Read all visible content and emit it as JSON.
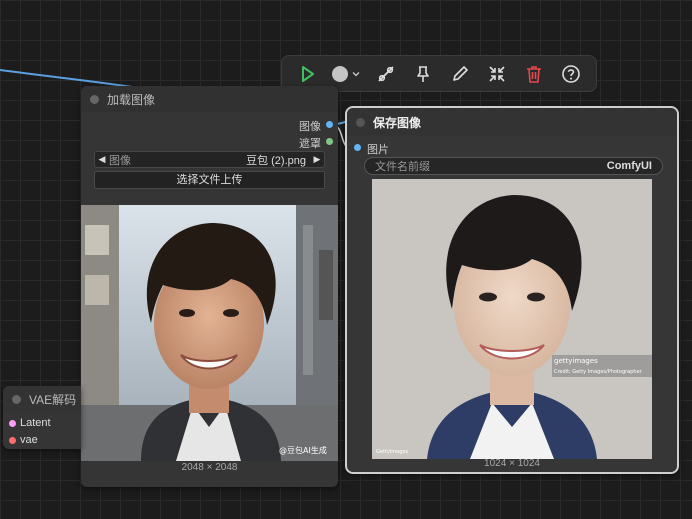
{
  "toolbar": {
    "icons": [
      "play-icon",
      "color-picker-icon",
      "bypass-icon",
      "pin-icon",
      "edit-icon",
      "collapse-icon",
      "delete-icon",
      "help-icon"
    ],
    "play_color": "#3fbf5f",
    "delete_color": "#e5484d"
  },
  "load_node": {
    "title": "加载图像",
    "outputs": [
      {
        "label": "图像",
        "color": "#64b5f6"
      },
      {
        "label": "遮罩",
        "color": "#81c784"
      }
    ],
    "image_combo": {
      "label": "图像",
      "value": "豆包 (2).png"
    },
    "upload_label": "选择文件上传",
    "size_label": "2048 × 2048",
    "watermark": "@豆包AI生成"
  },
  "save_node": {
    "title": "保存图像",
    "input": {
      "label": "图片",
      "color": "#64b5f6"
    },
    "prefix_field": {
      "label": "文件名前缀",
      "value": "ComfyUI"
    },
    "size_label": "1024 × 1024",
    "watermark_line1": "gettyimages",
    "watermark_line2": "Credit: Getty Images/Photographer",
    "watermark_corner": "GettyImages"
  },
  "vae_node": {
    "title": "VAE解码",
    "inputs": [
      {
        "label": "Latent",
        "color": "#ff9cf9"
      },
      {
        "label": "vae",
        "color": "#ff6e6e"
      }
    ]
  }
}
